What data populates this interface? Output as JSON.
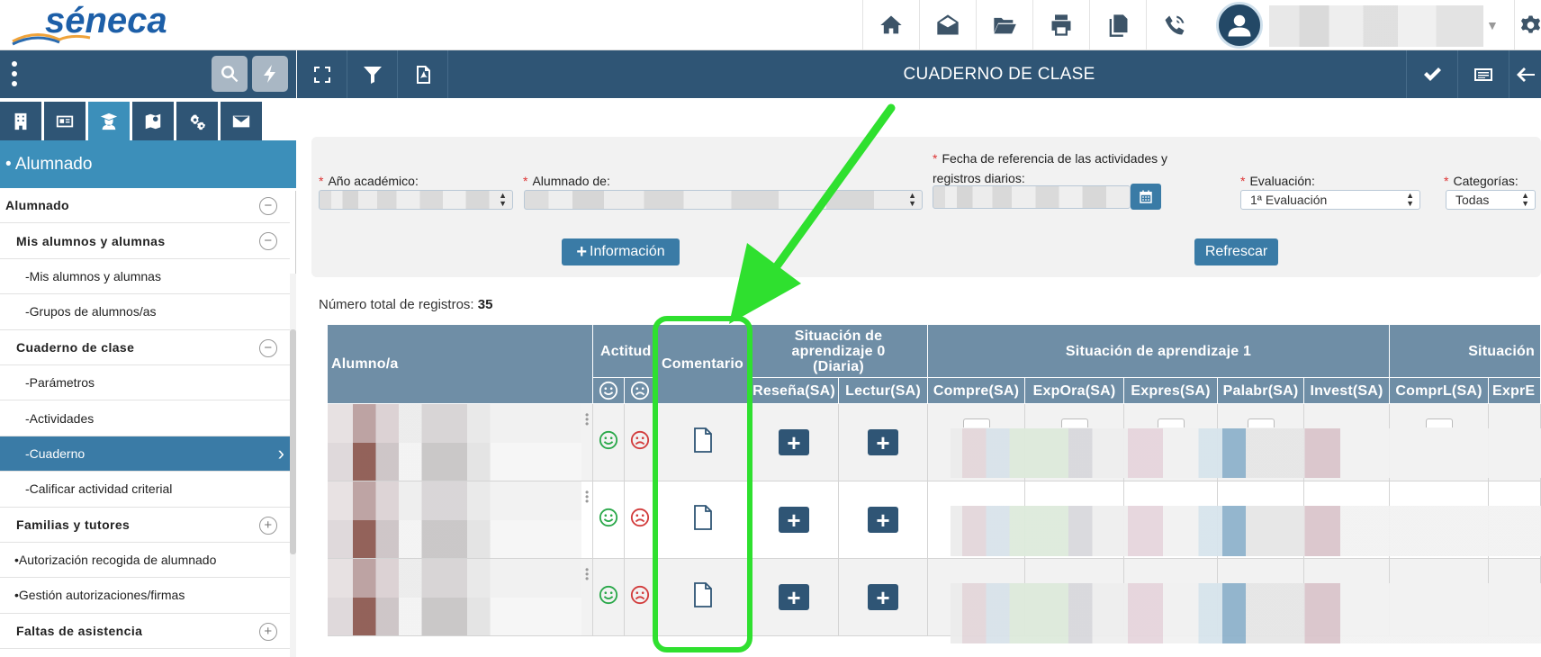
{
  "app": {
    "logo_text": "séneca",
    "page_title": "CUADERNO DE CLASE"
  },
  "colors": {
    "primary": "#2f5575",
    "accent": "#3c8fba",
    "button": "#3a7ba6",
    "header_cell": "#6f8ea6",
    "highlight": "#2fe02f",
    "smile": "#2aa84a",
    "frown": "#d23c3c"
  },
  "topbar": {
    "icons": [
      "home-icon",
      "envelope-open-icon",
      "folder-open-icon",
      "print-icon",
      "copy-icon",
      "phone-volume-icon"
    ],
    "user_icon": "user-avatar-icon",
    "settings_icon": "gear-icon"
  },
  "sidebar": {
    "toolbar_icons": [
      "vertical-dots-icon",
      "search-icon",
      "lightning-icon"
    ],
    "tabs": [
      "building-icon",
      "id-card-icon",
      "students-icon",
      "map-marker-icon",
      "gears-icon",
      "mail-icon"
    ],
    "section_title": "• Alumnado",
    "items": [
      {
        "label": "Alumnado",
        "toggle": "⊖"
      },
      {
        "label": "Mis alumnos y alumnas",
        "toggle": "⊖"
      },
      {
        "label": "-Mis alumnos y alumnas"
      },
      {
        "label": "-Grupos de alumnos/as"
      },
      {
        "label": "Cuaderno de clase",
        "toggle": "⊖"
      },
      {
        "label": "-Parámetros"
      },
      {
        "label": "-Actividades"
      },
      {
        "label": "-Cuaderno",
        "arrow": "›"
      },
      {
        "label": "-Calificar actividad criterial"
      },
      {
        "label": "Familias y tutores",
        "toggle": "+"
      },
      {
        "label": "•Autorización recogida de alumnado"
      },
      {
        "label": "•Gestión autorizaciones/firmas"
      },
      {
        "label": "Faltas de asistencia",
        "toggle": "+"
      }
    ]
  },
  "main_toolbar": {
    "left_icons": [
      "expand-icon",
      "filter-icon",
      "pdf-file-icon"
    ],
    "right_icons": [
      "check-icon",
      "list-card-icon",
      "arrow-left-icon"
    ]
  },
  "filters": {
    "year_label": "Año académico:",
    "students_label": "Alumnado de:",
    "date_label_line1": "Fecha de referencia de las actividades y",
    "date_label_line2": "registros diarios:",
    "evaluation_label": "Evaluación:",
    "evaluation_value": "1ª Evaluación",
    "categories_label": "Categorías:",
    "categories_value": "Todas",
    "required_mark": "*",
    "info_button": "Información",
    "refresh_button": "Refrescar"
  },
  "records": {
    "label": "Número total de registros:",
    "count": "35"
  },
  "table": {
    "col_student": "Alumno/a",
    "col_attitude": "Actitud",
    "col_comment": "Comentario",
    "group_sa0": "Situación de aprendizaje 0 (Diaria)",
    "group_sa1": "Situación de aprendizaje 1",
    "group_sa2": "Situación",
    "sub_sa0": [
      "Reseña(SA)",
      "Lectur(SA)"
    ],
    "sub_sa1": [
      "Compre(SA)",
      "ExpOra(SA)",
      "Expres(SA)",
      "Palabr(SA)",
      "Invest(SA)"
    ],
    "sub_sa2": [
      "ComprL(SA)",
      "ExprE"
    ],
    "rows": 3,
    "plus_label": "+"
  }
}
